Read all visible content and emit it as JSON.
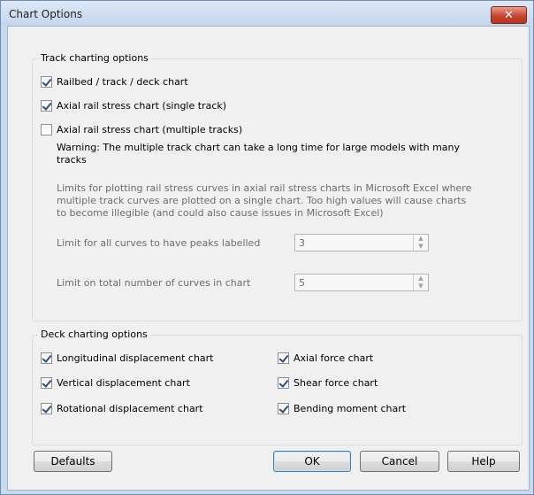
{
  "window": {
    "title": "Chart Options",
    "close_glyph": "✕"
  },
  "track_group": {
    "title": "Track charting options",
    "options": [
      {
        "label": "Railbed / track / deck chart",
        "checked": true
      },
      {
        "label": "Axial rail stress chart (single track)",
        "checked": true
      },
      {
        "label": "Axial rail stress chart (multiple tracks)",
        "checked": false
      }
    ],
    "warning_line1": "Warning: The multiple track chart can take a long time for large models with many",
    "warning_line2": "tracks",
    "limits_note_line1": "Limits for plotting rail stress curves in axial rail stress charts in Microsoft Excel where",
    "limits_note_line2": "multiple track curves are plotted on a single chart. Too high values will cause charts",
    "limits_note_line3": "to become illegible (and could also cause issues in Microsoft Excel)",
    "peaks_label": "Limit for all curves to have peaks labelled",
    "peaks_value": "3",
    "curves_label": "Limit on total number of curves in chart",
    "curves_value": "5"
  },
  "deck_group": {
    "title": "Deck charting options",
    "left": [
      {
        "label": "Longitudinal displacement chart",
        "checked": true
      },
      {
        "label": "Vertical displacement chart",
        "checked": true
      },
      {
        "label": "Rotational displacement chart",
        "checked": true
      }
    ],
    "right": [
      {
        "label": "Axial force chart",
        "checked": true
      },
      {
        "label": "Shear force chart",
        "checked": true
      },
      {
        "label": "Bending moment chart",
        "checked": true
      }
    ]
  },
  "buttons": {
    "defaults": "Defaults",
    "ok": "OK",
    "cancel": "Cancel",
    "help": "Help"
  },
  "icons": {
    "spin_up": "▲",
    "spin_down": "▼"
  }
}
